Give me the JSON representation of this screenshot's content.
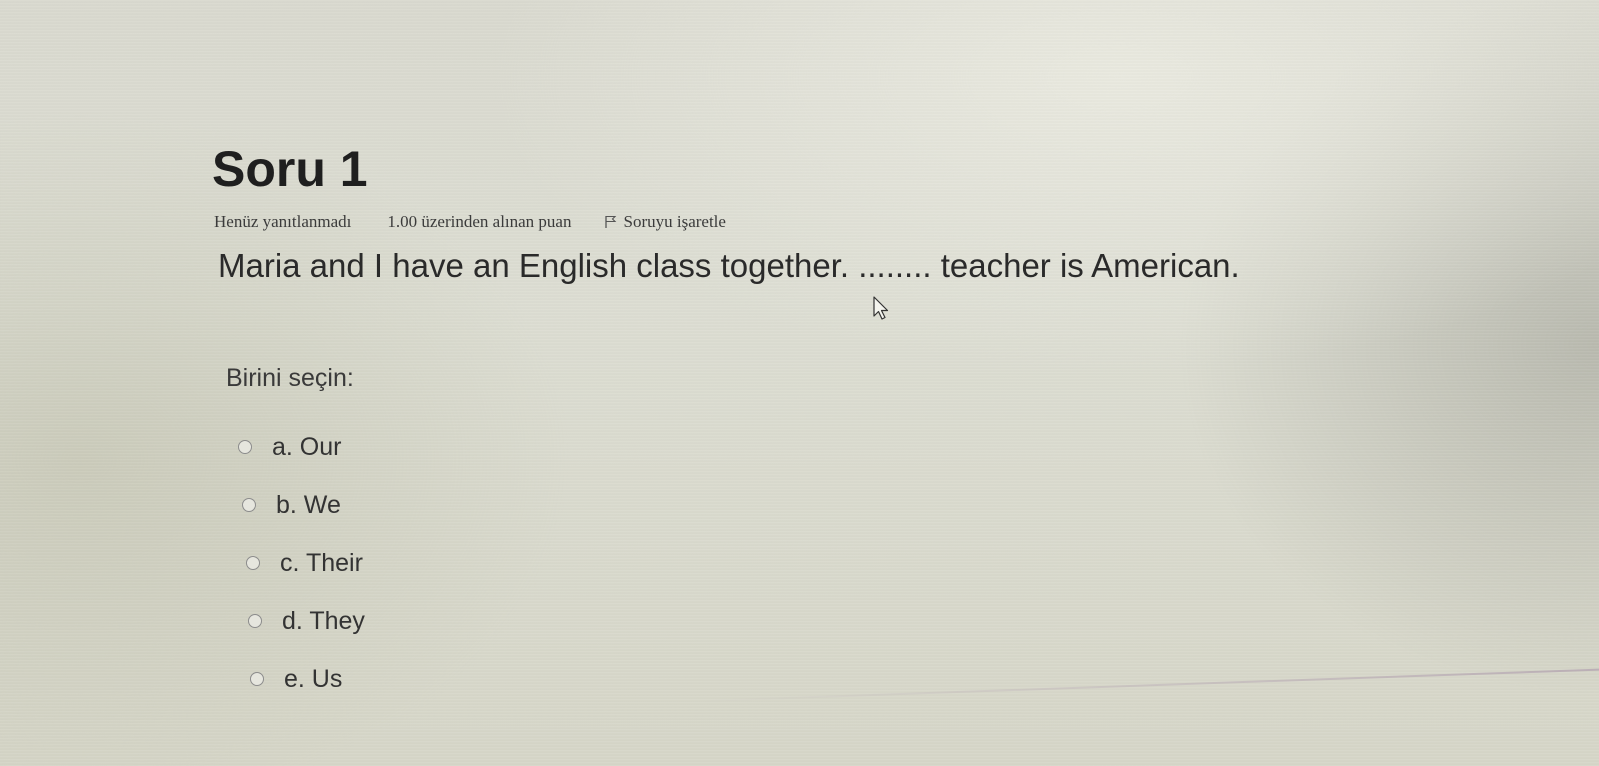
{
  "question": {
    "title": "Soru 1",
    "state": "Henüz yanıtlanmadı",
    "grade": "1.00 üzerinden alınan puan",
    "flag_label": "Soruyu işaretle",
    "flag_icon": "flag-icon",
    "text": "Maria and I have an English class together. ........ teacher is American."
  },
  "answer_prompt": "Birini seçin:",
  "answers": [
    {
      "label": "a. Our",
      "selected": false
    },
    {
      "label": "b. We",
      "selected": false
    },
    {
      "label": "c. Their",
      "selected": false
    },
    {
      "label": "d. They",
      "selected": false
    },
    {
      "label": "e. Us",
      "selected": false
    }
  ],
  "pointer_icon": "mouse-pointer-icon"
}
